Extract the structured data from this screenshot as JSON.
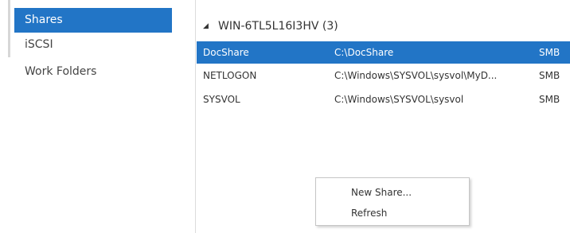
{
  "nav": {
    "items": [
      {
        "label": "Shares",
        "selected": true
      },
      {
        "label": "iSCSI",
        "selected": false
      },
      {
        "label": "Work Folders",
        "selected": false
      }
    ]
  },
  "shares": {
    "group_header": "WIN-6TL5L16I3HV (3)",
    "expand_icon": "collapse-triangle-icon",
    "rows": [
      {
        "name": "DocShare",
        "path": "C:\\DocShare",
        "protocol": "SMB",
        "selected": true
      },
      {
        "name": "NETLOGON",
        "path": "C:\\Windows\\SYSVOL\\sysvol\\MyD...",
        "protocol": "SMB",
        "selected": false
      },
      {
        "name": "SYSVOL",
        "path": "C:\\Windows\\SYSVOL\\sysvol",
        "protocol": "SMB",
        "selected": false
      }
    ]
  },
  "context_menu": {
    "items": [
      {
        "label": "New Share..."
      },
      {
        "label": "Refresh"
      }
    ]
  },
  "colors": {
    "selection": "#2275c6",
    "separator": "#dcdcdc"
  }
}
